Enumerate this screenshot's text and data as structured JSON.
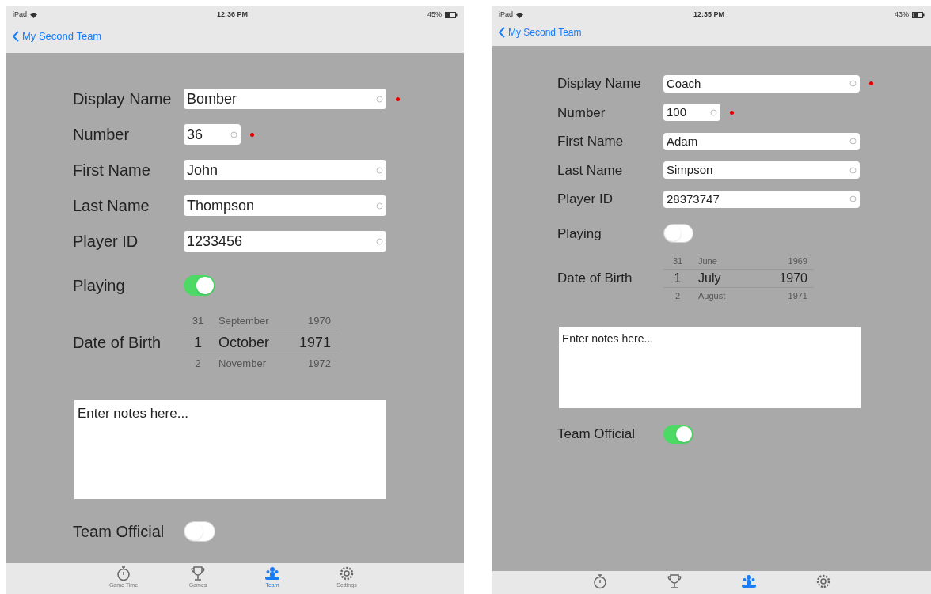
{
  "screens": [
    {
      "status_bar": {
        "carrier": "iPad",
        "time": "12:36 PM",
        "battery": "45%"
      },
      "back": "My Second Team",
      "fields": [
        {
          "label": "Display Name",
          "value": "Bomber",
          "kind": "text",
          "required": true
        },
        {
          "label": "Number",
          "value": "36",
          "kind": "number",
          "required": true
        },
        {
          "label": "First Name",
          "value": "John",
          "kind": "text",
          "required": false
        },
        {
          "label": "Last Name",
          "value": "Thompson",
          "kind": "text",
          "required": false
        },
        {
          "label": "Player ID",
          "value": "1233456",
          "kind": "text",
          "required": false
        }
      ],
      "playing": {
        "label": "Playing",
        "on": true
      },
      "date_of_birth": {
        "label": "Date of Birth",
        "rows": [
          {
            "day": "31",
            "month": "September",
            "year": "1970",
            "selected": false
          },
          {
            "day": "1",
            "month": "October",
            "year": "1971",
            "selected": true
          },
          {
            "day": "2",
            "month": "November",
            "year": "1972",
            "selected": false
          }
        ]
      },
      "notes": {
        "placeholder": "Enter notes here..."
      },
      "team_official": {
        "label": "Team Official",
        "on": false
      },
      "tabs": [
        {
          "kind": "timer",
          "label": "Game Time",
          "selected": false
        },
        {
          "kind": "trophy",
          "label": "Games",
          "selected": false
        },
        {
          "kind": "team",
          "label": "Team",
          "selected": true
        },
        {
          "kind": "settings",
          "label": "Settings",
          "selected": false
        }
      ]
    },
    {
      "status_bar": {
        "carrier": "iPad",
        "time": "12:35 PM",
        "battery": "43%"
      },
      "back": "My Second Team",
      "fields": [
        {
          "label": "Display Name",
          "value": "Coach",
          "kind": "text",
          "required": true
        },
        {
          "label": "Number",
          "value": "100",
          "kind": "number",
          "required": true
        },
        {
          "label": "First Name",
          "value": "Adam",
          "kind": "text",
          "required": false
        },
        {
          "label": "Last Name",
          "value": "Simpson",
          "kind": "text",
          "required": false
        },
        {
          "label": "Player ID",
          "value": "28373747",
          "kind": "text",
          "required": false
        }
      ],
      "playing": {
        "label": "Playing",
        "on": false
      },
      "date_of_birth": {
        "label": "Date of Birth",
        "rows": [
          {
            "day": "31",
            "month": "June",
            "year": "1969",
            "selected": false
          },
          {
            "day": "1",
            "month": "July",
            "year": "1970",
            "selected": true
          },
          {
            "day": "2",
            "month": "August",
            "year": "1971",
            "selected": false
          }
        ]
      },
      "notes": {
        "placeholder": "Enter notes here..."
      },
      "team_official": {
        "label": "Team Official",
        "on": true
      },
      "tabs": [
        {
          "kind": "timer",
          "selected": false
        },
        {
          "kind": "trophy",
          "selected": false
        },
        {
          "kind": "team",
          "selected": true
        },
        {
          "kind": "settings",
          "selected": false
        }
      ]
    }
  ]
}
